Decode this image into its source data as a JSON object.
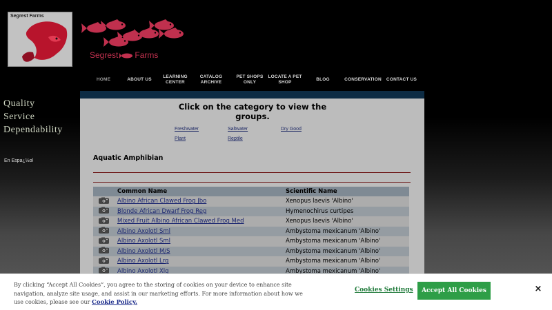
{
  "brand": {
    "logo_text": "Segrest Farms",
    "name_left": "Segrest",
    "name_right": "Farms",
    "accent_color": "#c0304e"
  },
  "nav": [
    {
      "label": "HOME",
      "active": true
    },
    {
      "label": "ABOUT US"
    },
    {
      "label": "LEARNING CENTER"
    },
    {
      "label": "CATALOG ARCHIVE"
    },
    {
      "label": "PET SHOPS ONLY"
    },
    {
      "label": "LOCATE A PET SHOP"
    },
    {
      "label": "BLOG"
    },
    {
      "label": "CONSERVATION"
    },
    {
      "label": "CONTACT US"
    }
  ],
  "sidebar": {
    "tagline": [
      "Quality",
      "Service",
      "Dependability"
    ],
    "language_link": "En Espa¿½ol"
  },
  "content": {
    "headline": "Click on the category to view the groups.",
    "categories": [
      "Freshwater",
      "Saltwater",
      "Dry Good",
      "Plant",
      "Reptile"
    ],
    "section_title": "Aquatic Amphibian",
    "table": {
      "headers": [
        "Common Name",
        "Scientific Name"
      ],
      "camera_icon": "camera-icon",
      "rows": [
        {
          "common": "Albino African Clawed Frog Jbo",
          "scientific": "Xenopus laevis 'Albino'"
        },
        {
          "common": "Blonde African Dwarf Frog Reg",
          "scientific": "Hymenochirus curtipes"
        },
        {
          "common": "Mixed Fruit Albino African Clawed Frog Med",
          "scientific": "Xenopus laevis 'Albino'"
        },
        {
          "common": "Albino Axolotl Sml",
          "scientific": "Ambystoma mexicanum 'Albino'"
        },
        {
          "common": "Albino Axolotl Sml",
          "scientific": "Ambystoma mexicanum 'Albino'"
        },
        {
          "common": "Albino Axolotl M/S",
          "scientific": "Ambystoma mexicanum 'Albino'"
        },
        {
          "common": "Albino Axolotl Lrg",
          "scientific": "Ambystoma mexicanum 'Albino'"
        },
        {
          "common": "Albino Axolotl Xlg",
          "scientific": "Ambystoma mexicanum 'Albino'"
        }
      ]
    }
  },
  "cookie_banner": {
    "text": "By clicking “Accept All Cookies”, you agree to the storing of cookies on your device to enhance site navigation, analyze site usage, and assist in our marketing efforts. For more information about how we use cookies, please see our",
    "policy_link": "Cookie Policy.",
    "settings_label": "Cookies Settings",
    "accept_label": "Accept All Cookies",
    "close_label": "×",
    "accept_color": "#2e9e47",
    "settings_color": "#1f7a3a"
  }
}
